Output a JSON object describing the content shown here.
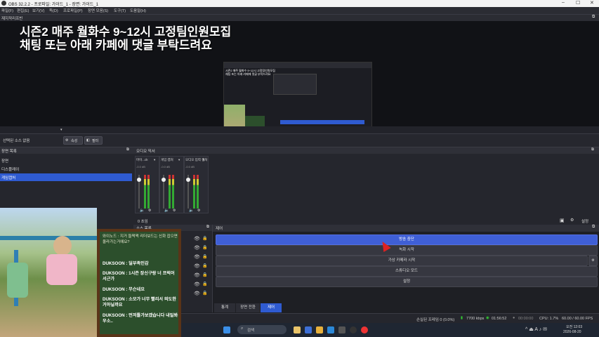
{
  "window": {
    "title": "OBS 32.2.2 - 프로파일: 가이드_1 - 장면: 가이드_1"
  },
  "menu": [
    "파일(F)",
    "편집(E)",
    "보기(V)",
    "독(D)",
    "프로파일(P)",
    "장면 모음(S)",
    "도구(T)",
    "도움말(H)"
  ],
  "preview": {
    "header": "재지작리프빈",
    "overlay_line1": "시즌2 매주 월화수 9~12시 고정팀인원모집",
    "overlay_line2": "채팅 또는 아래 카페에 댓글 부탁드려요",
    "nested_line1": "시즌2 매주 월화수 9~12시 고정팀인원모집",
    "nested_line2": "채팅 또는 아래 카페에 댓글 부탁드려요"
  },
  "source_toolbar": {
    "label": "선택된 소스 없음",
    "props": "속성",
    "filters": "필터"
  },
  "scenes": {
    "title": "장면 목록",
    "items": [
      "장면",
      "디스플레이",
      "게임캡처"
    ],
    "selected": 2
  },
  "mixer": {
    "title": "오디오 믹서",
    "channels": [
      {
        "name": "마이...ck",
        "db": "-0.0 dB"
      },
      {
        "name": "게임 캡처",
        "db": "-0.0 dB"
      },
      {
        "name": "오디오 입력 캡처",
        "db": "-0.0 dB"
      }
    ],
    "ticks": [
      "-5",
      "-10",
      "-15",
      "-20",
      "-25",
      "-30",
      "-35",
      "-40",
      "-45",
      "-50",
      "-55",
      "-60"
    ]
  },
  "controls_bar": {
    "label": "0 초임",
    "settings": "설정"
  },
  "sources": {
    "title": "소스 목록",
    "count": 7
  },
  "controls": {
    "title": "제어",
    "buttons": [
      "방송 중단",
      "녹화 시작",
      "가상 카메라 시작",
      "스튜디오 모드",
      "설정"
    ],
    "active": 0
  },
  "tabs": [
    "통계",
    "장면 전환",
    "제어"
  ],
  "active_tab": 2,
  "status": {
    "dropped": "손실된 프레임 0 (0.0%)",
    "kbps": "7700 kbps",
    "stream_time": "01:56:52",
    "rec_time": "00:00:00",
    "cpu": "CPU: 1.7%",
    "fps": "60.00 / 60.00 FPS"
  },
  "chat": {
    "messages": [
      {
        "user": "와이노드",
        "text": "지거 들쩍쩍 리더보드는 신화 잡으면 올라가는거에요?"
      },
      {
        "user": "DUKSOON",
        "text": "딜부족인감"
      },
      {
        "user": "DUKSOON",
        "text": "1시즌 장신구랑 너 프럭어서근가"
      },
      {
        "user": "DUKSOON",
        "text": "무슨네요"
      },
      {
        "user": "DUKSOON",
        "text": "소모가 너무 빨리서 의도한거아닐까요"
      },
      {
        "user": "DUKSOON",
        "text": "먼저틀가보겠습니다 내일봐우소.."
      }
    ]
  },
  "taskbar": {
    "search_placeholder": "검색",
    "time": "오전 12:03",
    "date": "2026-08-20"
  },
  "colors": {
    "accent": "#2f5bd1",
    "panel": "#25262d",
    "chat_board": "#2c4f2c",
    "chat_frame": "#5a3418"
  }
}
